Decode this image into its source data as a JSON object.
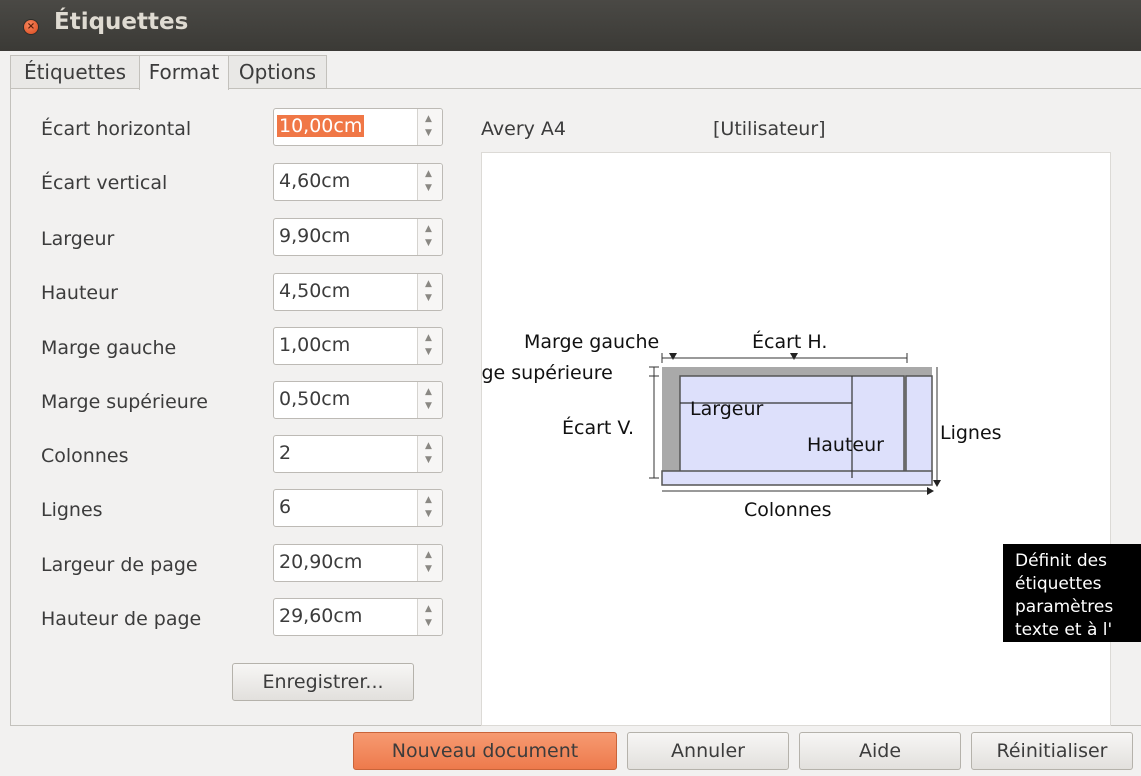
{
  "window": {
    "title": "Étiquettes"
  },
  "tabs": [
    {
      "label": "Étiquettes"
    },
    {
      "label": "Format"
    },
    {
      "label": "Options"
    }
  ],
  "fields": [
    {
      "label": "Écart horizontal",
      "value": "10,00cm"
    },
    {
      "label": "Écart vertical",
      "value": "4,60cm"
    },
    {
      "label": "Largeur",
      "value": "9,90cm"
    },
    {
      "label": "Hauteur",
      "value": "4,50cm"
    },
    {
      "label": "Marge gauche",
      "value": "1,00cm"
    },
    {
      "label": "Marge supérieure",
      "value": "0,50cm"
    },
    {
      "label": "Colonnes",
      "value": "2"
    },
    {
      "label": "Lignes",
      "value": "6"
    },
    {
      "label": "Largeur de page",
      "value": "20,90cm"
    },
    {
      "label": "Hauteur de page",
      "value": "29,60cm"
    }
  ],
  "save_button": "Enregistrer...",
  "brand": "Avery A4",
  "type": "[Utilisateur]",
  "diagram": {
    "marge_gauche": "Marge gauche",
    "ecart_h": "Écart H.",
    "marge_superieure": "rge supérieure",
    "ecart_v": "Écart V.",
    "largeur": "Largeur",
    "hauteur": "Hauteur",
    "lignes": "Lignes",
    "colonnes": "Colonnes"
  },
  "tooltip": [
    "Définit des",
    "étiquettes",
    "paramètres",
    "texte et à l'"
  ],
  "buttons": {
    "new_document": "Nouveau document",
    "cancel": "Annuler",
    "help": "Aide",
    "reset": "Réinitialiser"
  },
  "colors": {
    "accent": "#f07746",
    "titlebar": "#3c3b37",
    "label_fill": "#dde0fb"
  },
  "icons": {
    "close": "close-icon"
  }
}
